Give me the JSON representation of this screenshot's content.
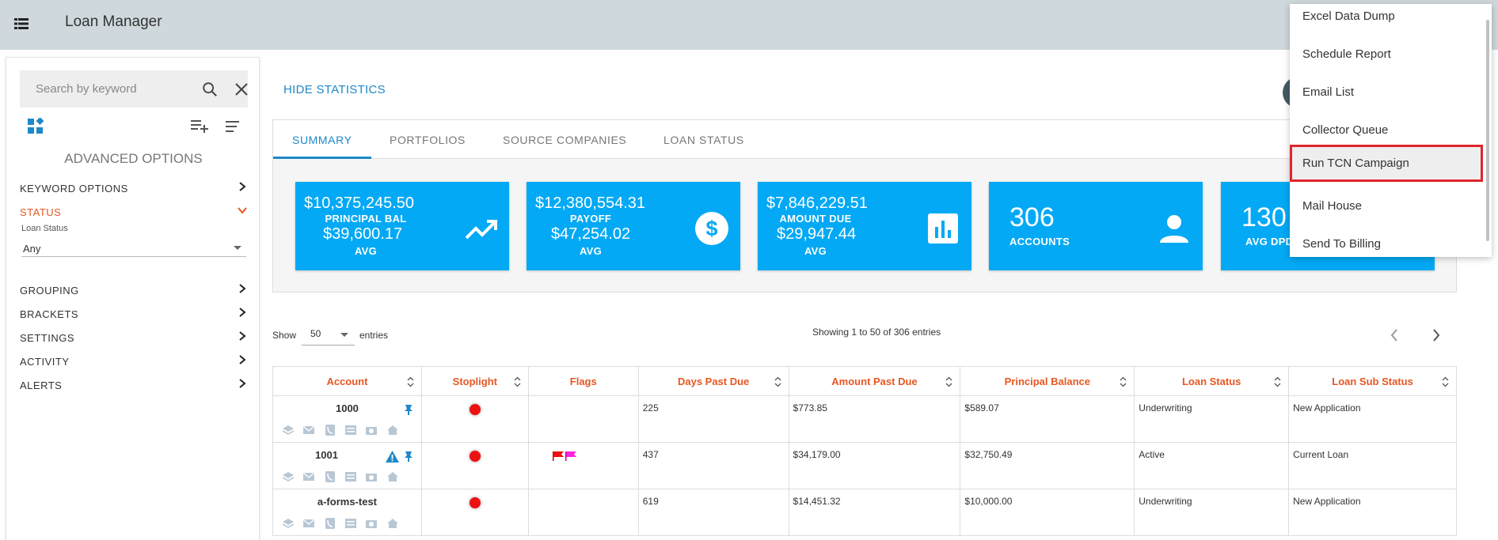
{
  "app": {
    "title": "Loan Manager"
  },
  "sidebar": {
    "search_placeholder": "Search by keyword",
    "advanced_title": "ADVANCED OPTIONS",
    "sections": [
      {
        "label": "KEYWORD OPTIONS"
      },
      {
        "label": "STATUS"
      },
      {
        "label": "GROUPING"
      },
      {
        "label": "BRACKETS"
      },
      {
        "label": "SETTINGS"
      },
      {
        "label": "ACTIVITY"
      },
      {
        "label": "ALERTS"
      }
    ],
    "status_filter": {
      "label": "Loan Status",
      "value": "Any"
    }
  },
  "main": {
    "hide_stats_label": "HIDE STATISTICS",
    "tabs": [
      {
        "label": "SUMMARY",
        "active": true
      },
      {
        "label": "PORTFOLIOS"
      },
      {
        "label": "SOURCE COMPANIES"
      },
      {
        "label": "LOAN STATUS"
      }
    ],
    "cards": [
      {
        "total": "$10,375,245.50",
        "label": "PRINCIPAL BAL",
        "avg": "$39,600.17",
        "avg_label": "AVG",
        "icon": "trending-up-icon"
      },
      {
        "total": "$12,380,554.31",
        "label": "PAYOFF",
        "avg": "$47,254.02",
        "avg_label": "AVG",
        "icon": "dollar-icon"
      },
      {
        "total": "$7,846,229.51",
        "label": "AMOUNT DUE",
        "avg": "$29,947.44",
        "avg_label": "AVG",
        "icon": "bar-chart-icon"
      },
      {
        "count": "306",
        "label": "ACCOUNTS",
        "icon": "person-icon"
      },
      {
        "count": "130",
        "label": "AVG DPD"
      }
    ],
    "table_controls": {
      "show_label": "Show",
      "page_size": "50",
      "entries_label": "entries",
      "showing_text": "Showing 1 to 50 of 306 entries"
    },
    "table": {
      "columns": [
        "Account",
        "Stoplight",
        "Flags",
        "Days Past Due",
        "Amount Past Due",
        "Principal Balance",
        "Loan Status",
        "Loan Sub Status"
      ],
      "rows": [
        {
          "account": "1000",
          "days_past_due": "225",
          "amount_past_due": "$773.85",
          "principal_balance": "$589.07",
          "loan_status": "Underwriting",
          "loan_sub_status": "New Application"
        },
        {
          "account": "1001",
          "days_past_due": "437",
          "amount_past_due": "$34,179.00",
          "principal_balance": "$32,750.49",
          "loan_status": "Active",
          "loan_sub_status": "Current Loan"
        },
        {
          "account": "a-forms-test",
          "days_past_due": "619",
          "amount_past_due": "$14,451.32",
          "principal_balance": "$10,000.00",
          "loan_status": "Underwriting",
          "loan_sub_status": "New Application"
        }
      ]
    }
  },
  "dropdown_menu": {
    "items": [
      {
        "label": "Excel Data Dump"
      },
      {
        "label": "Schedule Report"
      },
      {
        "label": "Email List"
      },
      {
        "label": "Collector Queue"
      },
      {
        "label": "Run TCN Campaign",
        "highlighted": true
      },
      {
        "label": "Mail House"
      },
      {
        "label": "Send To Billing"
      }
    ]
  },
  "colors": {
    "topbar": "#cfd8dc",
    "accent_blue": "#1e88c8",
    "card_blue": "#03a9f4",
    "accent_orange": "#e65722",
    "stoplight_red": "#ee1111",
    "highlight_border": "#e0242c"
  }
}
